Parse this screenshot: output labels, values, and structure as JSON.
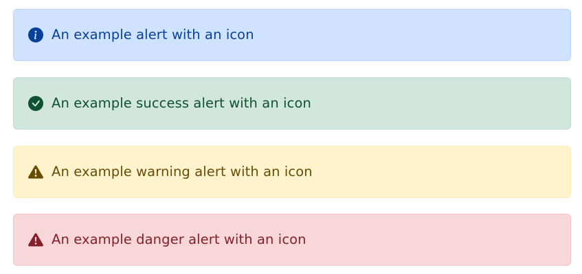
{
  "alerts": [
    {
      "variant": "info",
      "icon": "info-circle-icon",
      "text": "An example alert with an icon",
      "colors": {
        "background": "#cfe2ff",
        "border": "#b6d4fe",
        "text": "#084298"
      }
    },
    {
      "variant": "success",
      "icon": "check-circle-icon",
      "text": "An example success alert with an icon",
      "colors": {
        "background": "#d1e7dd",
        "border": "#badbcc",
        "text": "#0f5132"
      }
    },
    {
      "variant": "warning",
      "icon": "warning-triangle-icon",
      "text": "An example warning alert with an icon",
      "colors": {
        "background": "#fff3cd",
        "border": "#ffecb5",
        "text": "#664d03"
      }
    },
    {
      "variant": "danger",
      "icon": "danger-triangle-icon",
      "text": "An example danger alert with an icon",
      "colors": {
        "background": "#f8d7da",
        "border": "#f5c2c7",
        "text": "#842029"
      }
    }
  ]
}
